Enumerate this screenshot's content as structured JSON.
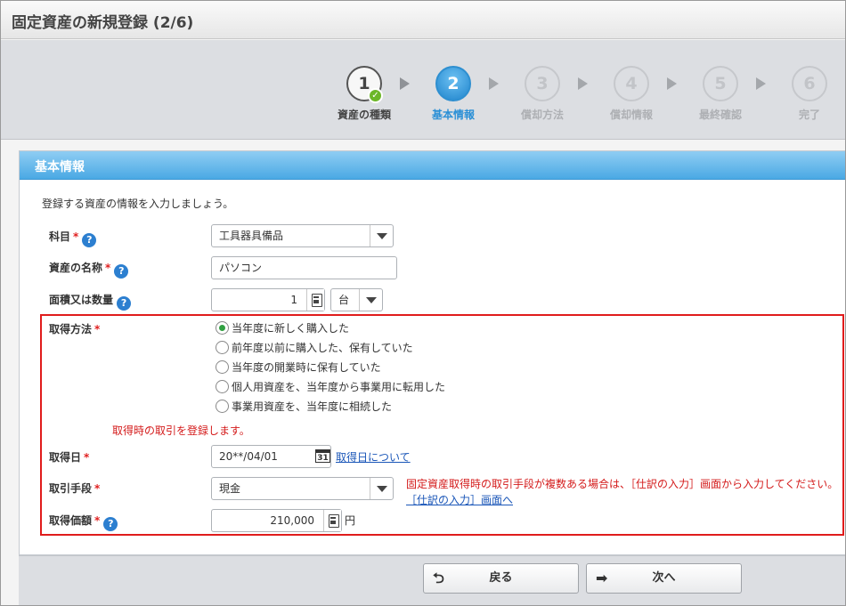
{
  "title": "固定資産の新規登録 (2/6)",
  "steps": [
    {
      "num": "1",
      "label": "資産の種類",
      "state": "done"
    },
    {
      "num": "2",
      "label": "基本情報",
      "state": "active"
    },
    {
      "num": "3",
      "label": "償却方法",
      "state": "todo"
    },
    {
      "num": "4",
      "label": "償却情報",
      "state": "todo"
    },
    {
      "num": "5",
      "label": "最終確認",
      "state": "todo"
    },
    {
      "num": "6",
      "label": "完了",
      "state": "todo"
    }
  ],
  "panel": {
    "header": "基本情報",
    "intro": "登録する資産の情報を入力しましょう。"
  },
  "fields": {
    "account": {
      "label": "科目",
      "value": "工具器具備品"
    },
    "asset_name": {
      "label": "資産の名称",
      "value": "パソコン"
    },
    "quantity": {
      "label": "面積又は数量",
      "value": "1",
      "unit": "台"
    },
    "acquisition_method": {
      "label": "取得方法",
      "options": [
        "当年度に新しく購入した",
        "前年度以前に購入した、保有していた",
        "当年度の開業時に保有していた",
        "個人用資産を、当年度から事業用に転用した",
        "事業用資産を、当年度に相続した"
      ],
      "selected_index": 0,
      "note": "取得時の取引を登録します。"
    },
    "acquisition_date": {
      "label": "取得日",
      "value": "20**/04/01",
      "link": "取得日について",
      "cal_day": "31"
    },
    "payment_method": {
      "label": "取引手段",
      "value": "現金",
      "warning": "固定資産取得時の取引手段が複数ある場合は、［仕訳の入力］画面から入力してください。",
      "link": "［仕訳の入力］画面へ"
    },
    "acquisition_price": {
      "label": "取得価額",
      "value": "210,000",
      "unit": "円"
    }
  },
  "buttons": {
    "back": "戻る",
    "next": "次へ"
  },
  "colors": {
    "accent": "#2a8fd6",
    "required": "#e02020",
    "highlight_border": "#e01c1c",
    "success": "#6cb728"
  }
}
